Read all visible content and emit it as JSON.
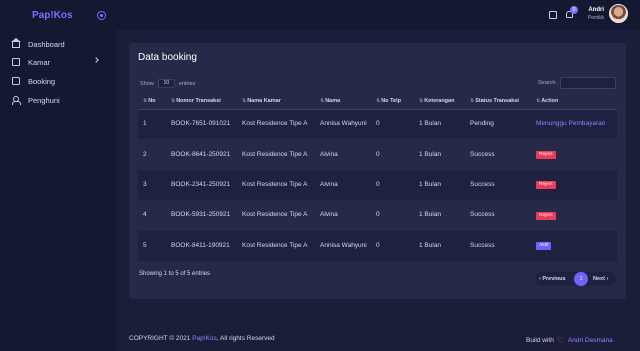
{
  "topbar": {
    "brand": "Pap!Kos",
    "notification_count": "0",
    "user_name": "Andri",
    "user_role": "Pemilik"
  },
  "sidebar": {
    "items": [
      {
        "label": "Dashboard",
        "icon": "home-icon"
      },
      {
        "label": "Kamar",
        "icon": "square-icon"
      },
      {
        "label": "Booking",
        "icon": "book-icon"
      },
      {
        "label": "Penghuni",
        "icon": "users-icon"
      }
    ]
  },
  "card": {
    "title": "Data booking",
    "show_label": "Show",
    "show_value": "10",
    "entries_label": "entries",
    "search_label": "Search:",
    "search_value": ""
  },
  "table": {
    "headers": [
      "No",
      "Nomor Transaksi",
      "Nama Kamar",
      "Nama",
      "No Telp",
      "Keterangan",
      "Status Transaksi",
      "Action"
    ],
    "rows": [
      {
        "no": "1",
        "nomor": "BOOK-7651-091021",
        "kamar": "Kost Residence Tipe A",
        "nama": "Annisa Wahyuni",
        "telp": "0",
        "ket": "1 Bulan",
        "status": "Pending",
        "action": "Menunggu Pembayaran"
      },
      {
        "no": "2",
        "nomor": "BOOK-8641-250921",
        "kamar": "Kost Residence Tipe A",
        "nama": "Alvina",
        "telp": "0",
        "ket": "1 Bulan",
        "status": "Success",
        "action": "Reject"
      },
      {
        "no": "3",
        "nomor": "BOOK-2341-250921",
        "kamar": "Kost Residence Tipe A",
        "nama": "Alvina",
        "telp": "0",
        "ket": "1 Bulan",
        "status": "Success",
        "action": "Reject"
      },
      {
        "no": "4",
        "nomor": "BOOK-5931-250921",
        "kamar": "Kost Residence Tipe A",
        "nama": "Alvina",
        "telp": "0",
        "ket": "1 Bulan",
        "status": "Success",
        "action": "Reject"
      },
      {
        "no": "5",
        "nomor": "BOOK-8411-190921",
        "kamar": "Kost Residence Tipe A",
        "nama": "Annisa Wahyuni",
        "telp": "0",
        "ket": "1 Bulan",
        "status": "Success",
        "action": "Aktif"
      }
    ]
  },
  "pagination": {
    "info": "Showing 1 to 5 of 5 entries",
    "prev": "‹ Previous",
    "page": "1",
    "next": "Next ›"
  },
  "footer": {
    "copyright_prefix": "COPYRIGHT © 2021",
    "brand": "Pap!Kos",
    "copyright_suffix": ", All rights Reserved",
    "built_with": "Build with",
    "author": "Andri Desmana"
  },
  "colors": {
    "background": "#1b1e38",
    "sidebar": "#151831",
    "card": "#262a48",
    "accent": "#6f63ff",
    "danger": "#ea3b5a"
  }
}
